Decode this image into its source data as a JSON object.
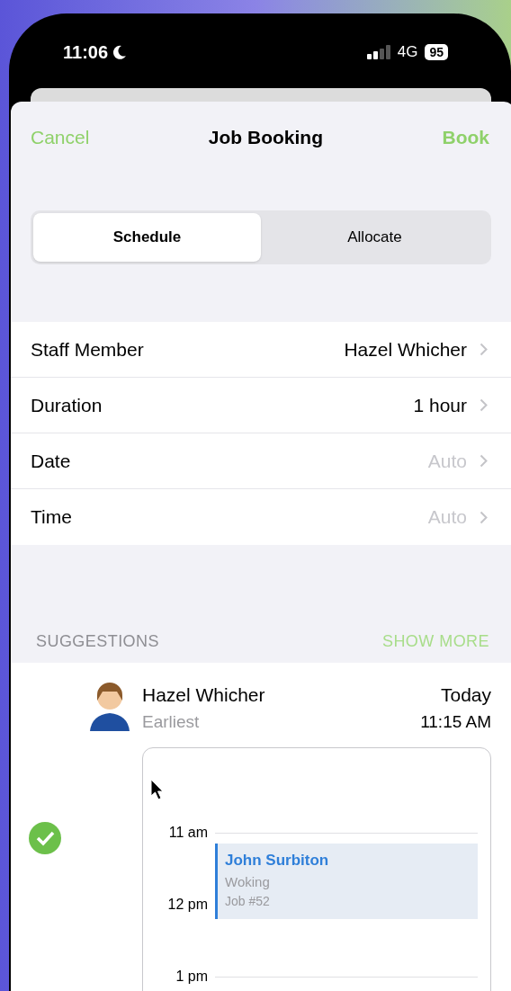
{
  "status_bar": {
    "time": "11:06",
    "network": "4G",
    "battery": "95"
  },
  "nav": {
    "cancel": "Cancel",
    "title": "Job Booking",
    "confirm": "Book"
  },
  "segments": [
    {
      "label": "Schedule",
      "selected": true
    },
    {
      "label": "Allocate",
      "selected": false
    }
  ],
  "fields": [
    {
      "label": "Staff Member",
      "value": "Hazel Whicher",
      "is_default": false
    },
    {
      "label": "Duration",
      "value": "1 hour",
      "is_default": false
    },
    {
      "label": "Date",
      "value": "Auto",
      "is_default": true
    },
    {
      "label": "Time",
      "value": "Auto",
      "is_default": true
    }
  ],
  "suggestions": {
    "header": "SUGGESTIONS",
    "show_more": "SHOW MORE",
    "items": [
      {
        "name": "Hazel Whicher",
        "subtitle": "Earliest",
        "day": "Today",
        "time": "11:15 AM",
        "selected": true,
        "calendar": {
          "hours": [
            "11 am",
            "12 pm",
            "1 pm"
          ],
          "events": [
            {
              "title": "John Surbiton",
              "location": "Woking",
              "job": "Job #52"
            }
          ]
        }
      }
    ]
  }
}
